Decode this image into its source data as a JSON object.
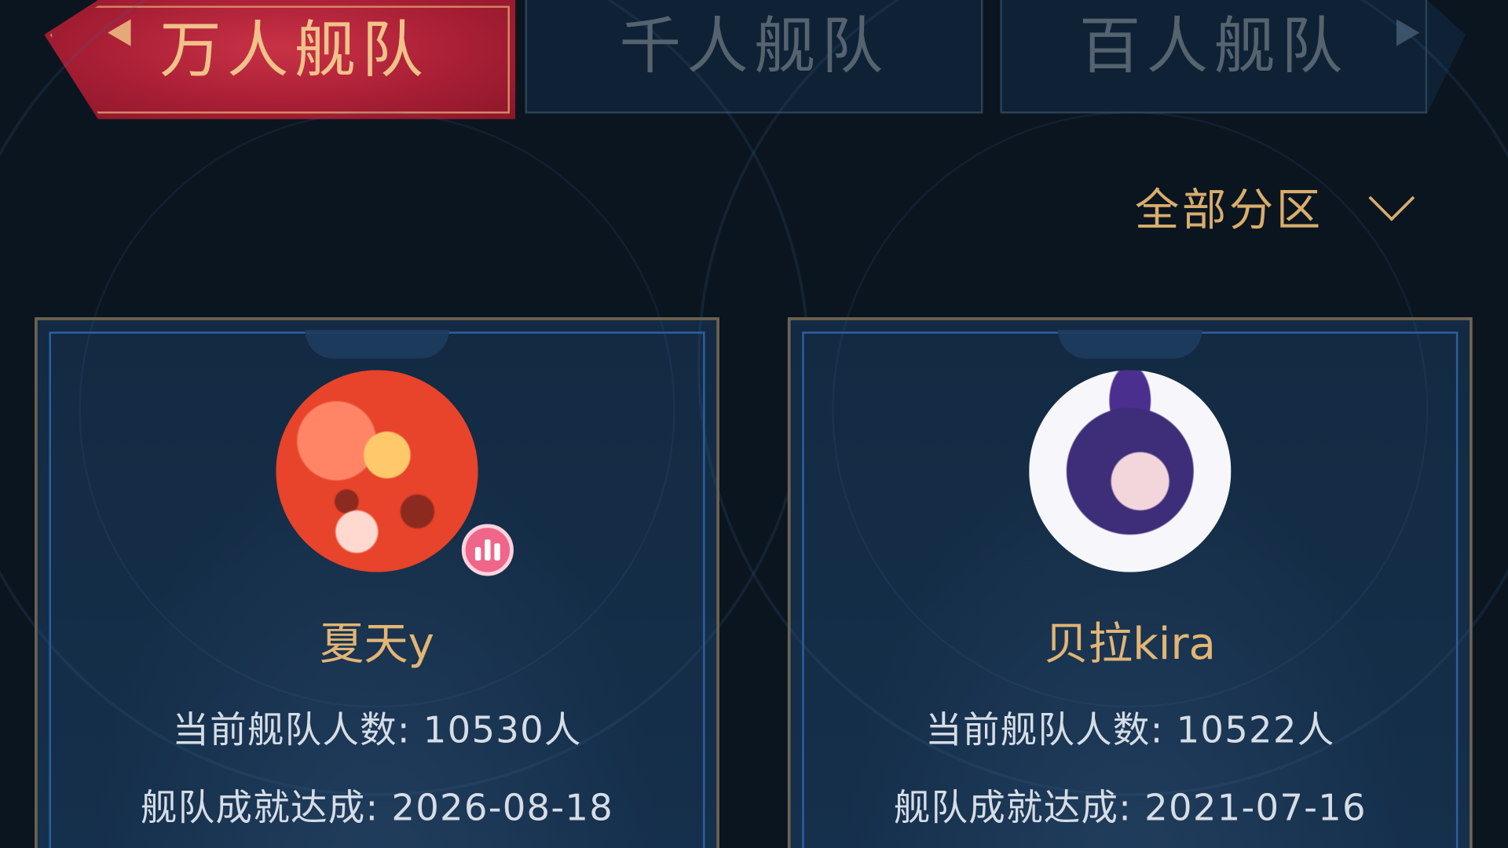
{
  "tabs": [
    {
      "label": "万人舰队",
      "active": true
    },
    {
      "label": "千人舰队",
      "active": false
    },
    {
      "label": "百人舰队",
      "active": false
    }
  ],
  "filter": {
    "label": "全部分区",
    "icon": "chevron-down-icon"
  },
  "cards": [
    {
      "name": "夏天y",
      "count_label": "当前舰队人数: ",
      "count_value": "10530人",
      "date_label": "舰队成就达成: ",
      "date_value": "2026-08-18",
      "live": true
    },
    {
      "name": "贝拉kira",
      "count_label": "当前舰队人数: ",
      "count_value": "10522人",
      "date_label": "舰队成就达成: ",
      "date_value": "2021-07-16",
      "live": false
    }
  ],
  "colors": {
    "background": "#0b1520",
    "active_tab": "#a91f35",
    "gold_text": "#d8ad6c",
    "card_border": "#6e6452",
    "live_badge": "#f0658a"
  }
}
